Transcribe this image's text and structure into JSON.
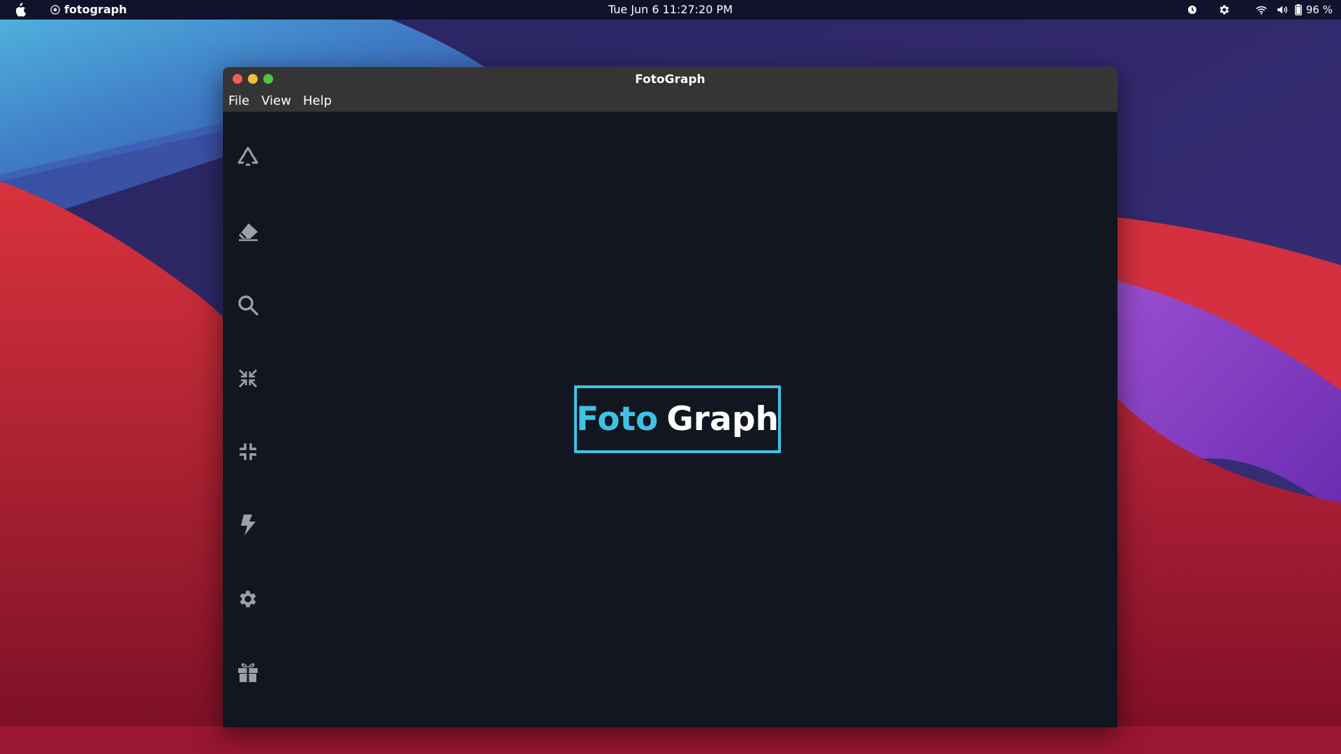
{
  "menubar": {
    "app_name": "fotograph",
    "clock": "Tue Jun 6  11:27:20 PM",
    "battery": "96 %",
    "icons": [
      "apple-icon",
      "app-icon",
      "clock-icon",
      "settings-icon",
      "wifi-icon",
      "volume-icon",
      "battery-icon"
    ]
  },
  "window": {
    "title": "FotoGraph",
    "menu": [
      "File",
      "View",
      "Help"
    ]
  },
  "sidebar": {
    "tools": [
      "recycle-icon",
      "eraser-icon",
      "search-icon",
      "compress-arrows-icon",
      "minimize-icon",
      "bolt-icon",
      "gear-icon",
      "gift-icon"
    ]
  },
  "logo": {
    "part1": "Foto",
    "part2": "Graph"
  },
  "colors": {
    "accent": "#3ec3e6",
    "content_bg": "#121620",
    "titlebar_bg": "#353535",
    "icon": "#9aa0a8"
  }
}
